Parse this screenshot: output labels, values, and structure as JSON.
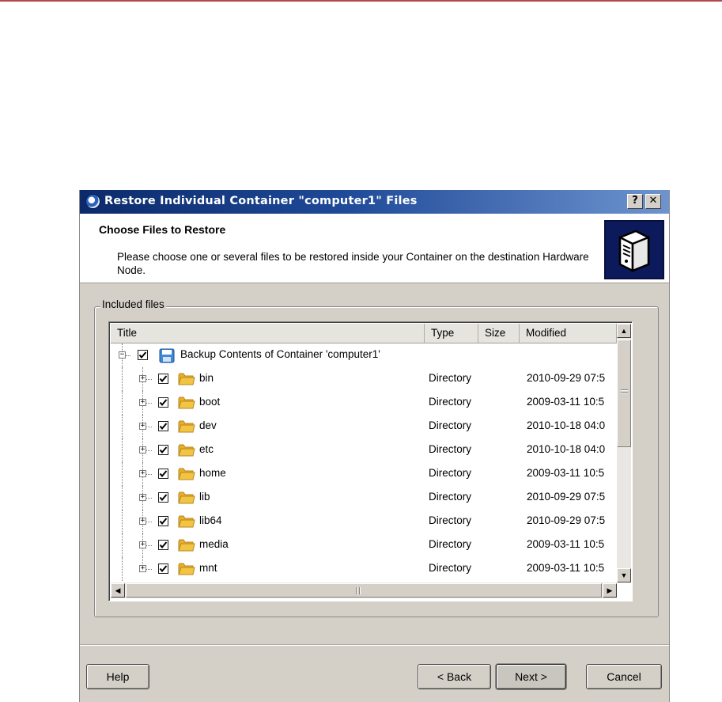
{
  "window": {
    "title": "Restore Individual Container \"computer1\" Files",
    "help_glyph": "?",
    "close_glyph": "✕"
  },
  "header": {
    "title": "Choose Files to Restore",
    "description": "Please choose one or several files to be restored inside your Container on the destination Hardware Node.",
    "icon": "server-icon"
  },
  "group": {
    "label": "Included files"
  },
  "table": {
    "columns": [
      {
        "label": "Title"
      },
      {
        "label": "Type"
      },
      {
        "label": "Size"
      },
      {
        "label": "Modified"
      }
    ],
    "root": {
      "label": "Backup Contents of Container 'computer1'",
      "checked": true,
      "expanded": true,
      "icon": "backup-disk-icon"
    },
    "rows": [
      {
        "title": "bin",
        "type": "Directory",
        "size": "",
        "modified": "2010-09-29 07:5",
        "checked": true
      },
      {
        "title": "boot",
        "type": "Directory",
        "size": "",
        "modified": "2009-03-11 10:5",
        "checked": true
      },
      {
        "title": "dev",
        "type": "Directory",
        "size": "",
        "modified": "2010-10-18 04:0",
        "checked": true
      },
      {
        "title": "etc",
        "type": "Directory",
        "size": "",
        "modified": "2010-10-18 04:0",
        "checked": true
      },
      {
        "title": "home",
        "type": "Directory",
        "size": "",
        "modified": "2009-03-11 10:5",
        "checked": true
      },
      {
        "title": "lib",
        "type": "Directory",
        "size": "",
        "modified": "2010-09-29 07:5",
        "checked": true
      },
      {
        "title": "lib64",
        "type": "Directory",
        "size": "",
        "modified": "2010-09-29 07:5",
        "checked": true
      },
      {
        "title": "media",
        "type": "Directory",
        "size": "",
        "modified": "2009-03-11 10:5",
        "checked": true
      },
      {
        "title": "mnt",
        "type": "Directory",
        "size": "",
        "modified": "2009-03-11 10:5",
        "checked": true
      }
    ]
  },
  "buttons": {
    "help": "Help",
    "back": "< Back",
    "next": "Next >",
    "cancel": "Cancel"
  },
  "colors": {
    "title_bar_start": "#0c2a6a",
    "title_bar_end": "#6e94cf",
    "dialog_face": "#d4d0c8",
    "folder_yellow": "#f2c443",
    "top_rule": "#b5484d"
  }
}
